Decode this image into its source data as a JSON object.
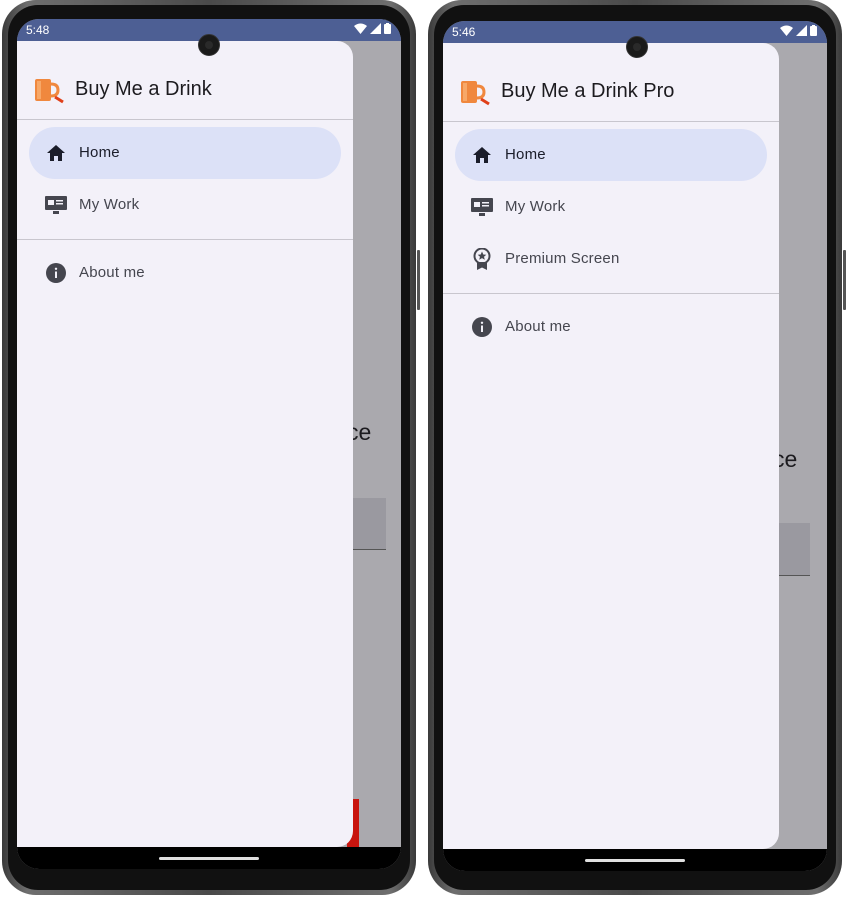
{
  "phones": [
    {
      "status_time": "5:48",
      "app_title": "Buy Me a Drink",
      "background_text": "ce",
      "nav_items": [
        {
          "label": "Home",
          "icon": "home-icon",
          "selected": true
        },
        {
          "label": "My Work",
          "icon": "monitor-icon",
          "selected": false
        },
        {
          "label": "About me",
          "icon": "info-icon",
          "selected": false
        }
      ]
    },
    {
      "status_time": "5:46",
      "app_title": "Buy Me a Drink Pro",
      "background_text": "ce",
      "nav_items": [
        {
          "label": "Home",
          "icon": "home-icon",
          "selected": true
        },
        {
          "label": "My Work",
          "icon": "monitor-icon",
          "selected": false
        },
        {
          "label": "Premium Screen",
          "icon": "premium-badge-icon",
          "selected": false
        },
        {
          "label": "About me",
          "icon": "info-icon",
          "selected": false
        }
      ]
    }
  ],
  "colors": {
    "status_bar": "#4d5f94",
    "drawer_bg": "#f3f1f9",
    "selected_item_bg": "#dce1f7",
    "scrim": "#aaa9ae",
    "accent_red": "#c8150f",
    "app_icon": "#f0883e"
  }
}
